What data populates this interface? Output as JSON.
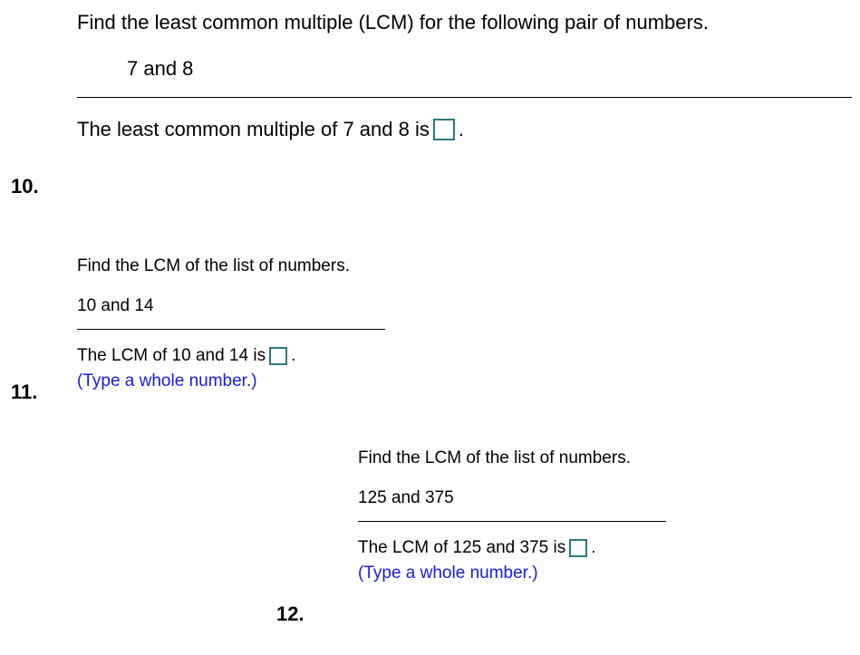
{
  "q10": {
    "number": "10.",
    "instruction": "Find the least common multiple (LCM) for the following pair of numbers.",
    "pair": "7 and 8",
    "answer_pre": "The least common multiple of 7 and 8 is ",
    "answer_post": "."
  },
  "q11": {
    "number": "11.",
    "instruction": "Find the LCM of the list of numbers.",
    "pair": "10 and 14",
    "answer_pre": "The LCM of 10 and 14 is ",
    "answer_post": ".",
    "hint": "(Type a whole number.)"
  },
  "q12": {
    "number": "12.",
    "instruction": "Find the LCM of the list of numbers.",
    "pair": "125 and 375",
    "answer_pre": "The LCM of 125 and 375 is ",
    "answer_post": ".",
    "hint": "(Type a whole number.)"
  }
}
